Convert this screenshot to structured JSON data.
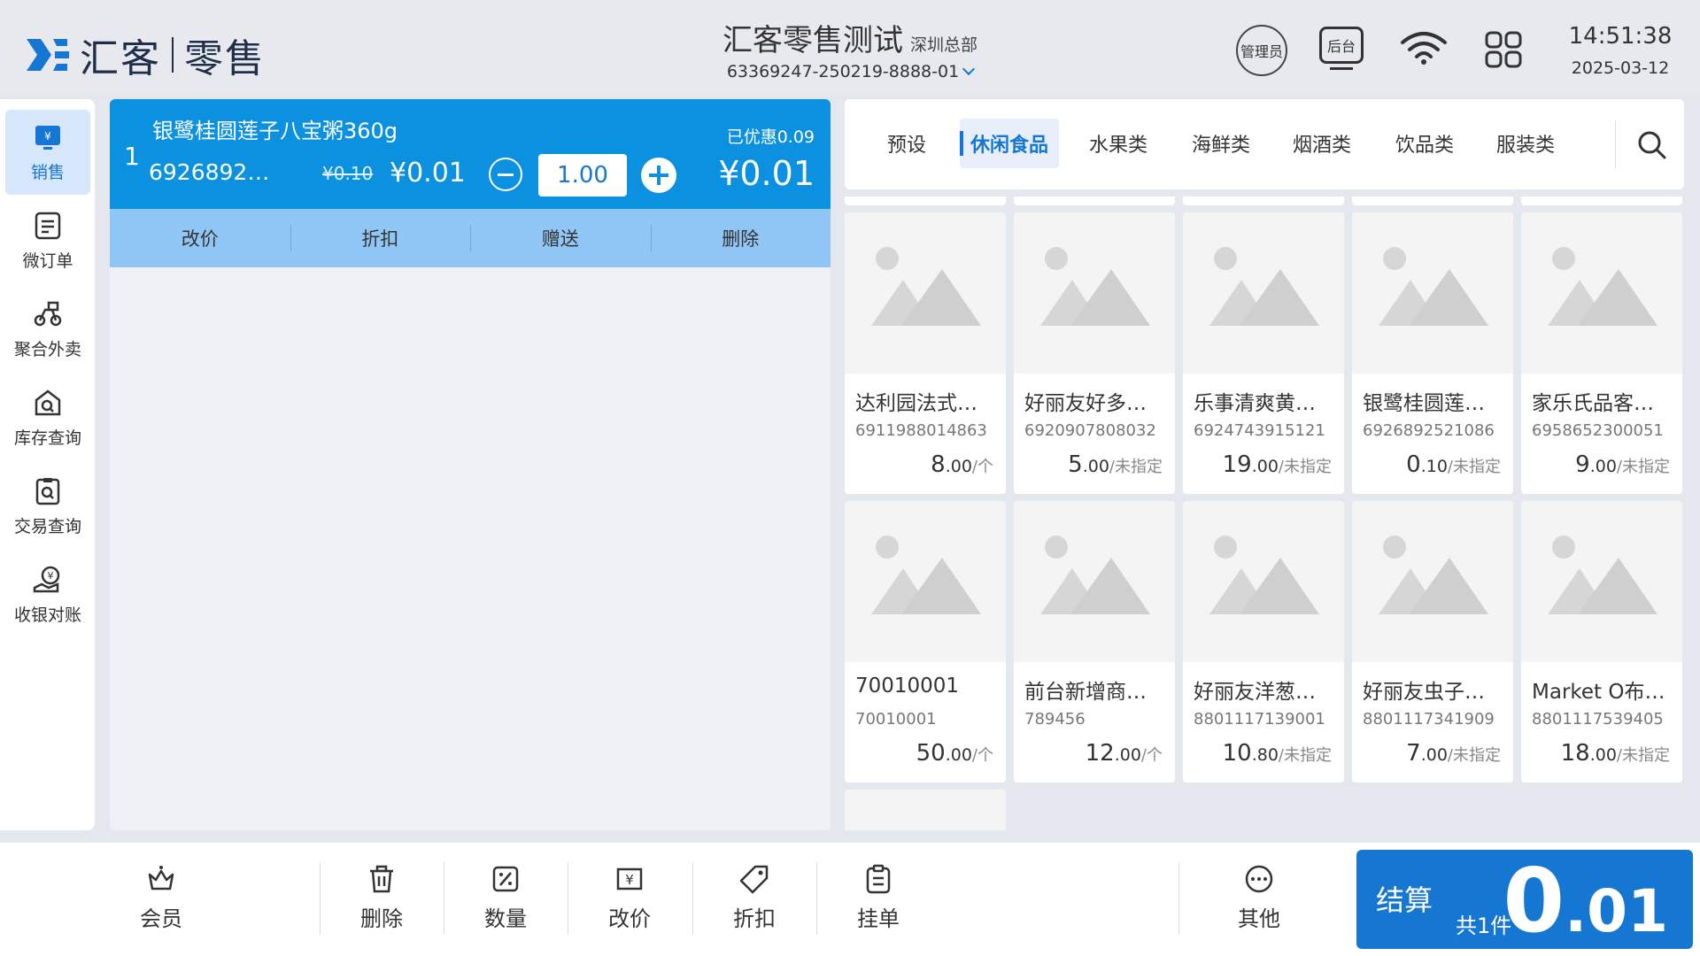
{
  "header": {
    "brand": "汇客",
    "product": "零售",
    "store_name": "汇客零售测试",
    "store_sub": "深圳总部",
    "store_id": "63369247-250219-8888-01",
    "btn_admin": "管理员",
    "btn_backend": "后台",
    "time": "14:51:38",
    "date": "2025-03-12"
  },
  "sidebar": {
    "items": [
      {
        "label": "销售",
        "icon": "sales-icon"
      },
      {
        "label": "微订单",
        "icon": "order-icon"
      },
      {
        "label": "聚合外卖",
        "icon": "delivery-icon"
      },
      {
        "label": "库存查询",
        "icon": "inventory-icon"
      },
      {
        "label": "交易查询",
        "icon": "transaction-icon"
      },
      {
        "label": "收银对账",
        "icon": "reconcile-icon"
      }
    ]
  },
  "cart": {
    "index": "1",
    "name": "银鹭桂圆莲子八宝粥360g",
    "code": "69268925…",
    "old_price": "¥0.10",
    "price": "¥0.01",
    "qty": "1.00",
    "discount": "已优惠0.09",
    "total": "¥0.01",
    "actions": [
      "改价",
      "折扣",
      "赠送",
      "删除"
    ]
  },
  "categories": {
    "items": [
      "预设",
      "休闲食品",
      "水果类",
      "海鲜类",
      "烟酒类",
      "饮品类",
      "服装类"
    ],
    "active": "休闲食品"
  },
  "products": [
    {
      "name": "达利园法式…",
      "code": "6911988014863",
      "price_int": "8",
      "price_dec": ".00",
      "unit": "/个"
    },
    {
      "name": "好丽友好多…",
      "code": "6920907808032",
      "price_int": "5",
      "price_dec": ".00",
      "unit": "/未指定"
    },
    {
      "name": "乐事清爽黄…",
      "code": "6924743915121",
      "price_int": "19",
      "price_dec": ".00",
      "unit": "/未指定"
    },
    {
      "name": "银鹭桂圆莲…",
      "code": "6926892521086",
      "price_int": "0",
      "price_dec": ".10",
      "unit": "/未指定"
    },
    {
      "name": "家乐氏品客…",
      "code": "6958652300051",
      "price_int": "9",
      "price_dec": ".00",
      "unit": "/未指定"
    },
    {
      "name": "70010001",
      "code": "70010001",
      "price_int": "50",
      "price_dec": ".00",
      "unit": "/个"
    },
    {
      "name": "前台新增商…",
      "code": "789456",
      "price_int": "12",
      "price_dec": ".00",
      "unit": "/个"
    },
    {
      "name": "好丽友洋葱…",
      "code": "8801117139001",
      "price_int": "10",
      "price_dec": ".80",
      "unit": "/未指定"
    },
    {
      "name": "好丽友虫子…",
      "code": "8801117341909",
      "price_int": "7",
      "price_dec": ".00",
      "unit": "/未指定"
    },
    {
      "name": "Market O布…",
      "code": "8801117539405",
      "price_int": "18",
      "price_dec": ".00",
      "unit": "/未指定"
    }
  ],
  "bottombar": {
    "member": "会员",
    "delete": "删除",
    "quantity": "数量",
    "reprice": "改价",
    "discount": "折扣",
    "hold": "挂单",
    "other": "其他"
  },
  "checkout": {
    "label": "结算",
    "count": "共1件",
    "amount_int": "0",
    "amount_dec": ".01"
  },
  "colors": {
    "primary": "#1677d2",
    "cart_row": "#0b91e0",
    "cart_actions": "#90c6f5"
  }
}
